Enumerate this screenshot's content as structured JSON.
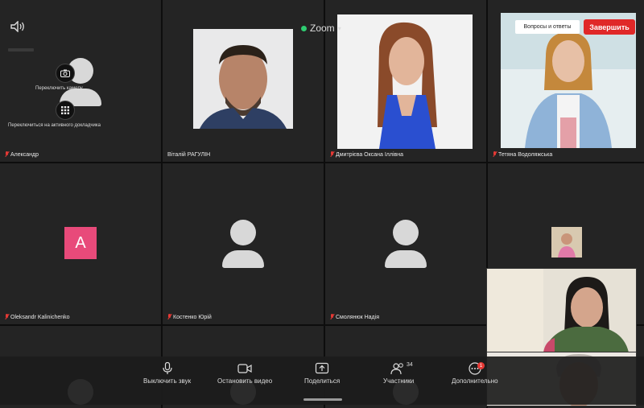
{
  "top_bar": {
    "app_title": "Zoom",
    "qa_label": "Вопросы и ответы",
    "end_label": "Завершить"
  },
  "overlay_menu": {
    "switch_camera": "Переключить камеру",
    "switch_active_speaker": "Переключиться на активного докладчика"
  },
  "participants": [
    {
      "name": "Александр",
      "muted": true
    },
    {
      "name": "Віталій РАГУЛІН",
      "muted": false
    },
    {
      "name": "Дмитрієва Оксана Іллівна",
      "muted": true
    },
    {
      "name": "Тетяна Водоляжська",
      "muted": true
    },
    {
      "name": "Oleksandr Kalinichenko",
      "muted": true,
      "avatar_letter": "A"
    },
    {
      "name": "Костенко Юрій",
      "muted": true
    },
    {
      "name": "Смолянюк Надія",
      "muted": true
    }
  ],
  "toolbar": {
    "mute_label": "Выключить звук",
    "stop_video_label": "Остановить видео",
    "share_label": "Поделиться",
    "participants_label": "Участники",
    "participants_count": "34",
    "more_label": "Дополнительно",
    "more_badge": "1"
  },
  "colors": {
    "end_button": "#e02828",
    "avatar_bg": "#e84a7a",
    "muted_icon": "#e53935",
    "status_dot": "#2ecc71"
  }
}
